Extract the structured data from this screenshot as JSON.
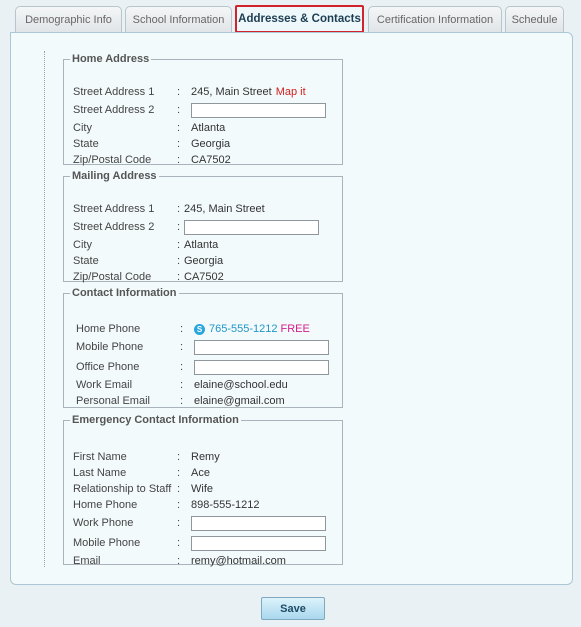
{
  "tabs": [
    {
      "label": "Demographic Info"
    },
    {
      "label": "School Information"
    },
    {
      "label": "Addresses & Contacts"
    },
    {
      "label": "Certification Information"
    },
    {
      "label": "Schedule"
    }
  ],
  "active_tab": "Addresses & Contacts",
  "home_address": {
    "legend": "Home Address",
    "street1_label": "Street Address 1",
    "street1_value": "245, Main Street",
    "map_link": "Map it",
    "street2_label": "Street Address 2",
    "street2_value": "",
    "city_label": "City",
    "city_value": "Atlanta",
    "state_label": "State",
    "state_value": "Georgia",
    "zip_label": "Zip/Postal Code",
    "zip_value": "CA7502"
  },
  "mailing_address": {
    "legend": "Mailing Address",
    "street1_label": "Street Address 1",
    "street1_value": "245, Main Street",
    "street2_label": "Street Address 2",
    "street2_value": "",
    "city_label": "City",
    "city_value": "Atlanta",
    "state_label": "State",
    "state_value": "Georgia",
    "zip_label": "Zip/Postal Code",
    "zip_value": "CA7502"
  },
  "contact_info": {
    "legend": "Contact Information",
    "home_phone_label": "Home Phone",
    "home_phone_value": "765-555-1212",
    "free_label": "FREE",
    "mobile_phone_label": "Mobile Phone",
    "mobile_phone_value": "",
    "office_phone_label": "Office Phone",
    "office_phone_value": "",
    "work_email_label": "Work Email",
    "work_email_value": "elaine@school.edu",
    "personal_email_label": "Personal Email",
    "personal_email_value": "elaine@gmail.com"
  },
  "emergency_contact": {
    "legend": "Emergency Contact Information",
    "first_name_label": "First Name",
    "first_name_value": "Remy",
    "last_name_label": "Last Name",
    "last_name_value": "Ace",
    "relationship_label": "Relationship to Staff",
    "relationship_value": "Wife",
    "home_phone_label": "Home Phone",
    "home_phone_value": "898-555-1212",
    "work_phone_label": "Work Phone",
    "work_phone_value": "",
    "mobile_phone_label": "Mobile Phone",
    "mobile_phone_value": "",
    "email_label": "Email",
    "email_value": "remy@hotmail.com"
  },
  "colon": ":",
  "save_label": "Save",
  "colors": {
    "active_tab_border": "#d0232b",
    "map_link": "#d2201f",
    "phone_link": "#2196c7",
    "free": "#d51e8a",
    "skype": "#2aa6dd"
  },
  "icons": {
    "skype": "skype-icon"
  }
}
